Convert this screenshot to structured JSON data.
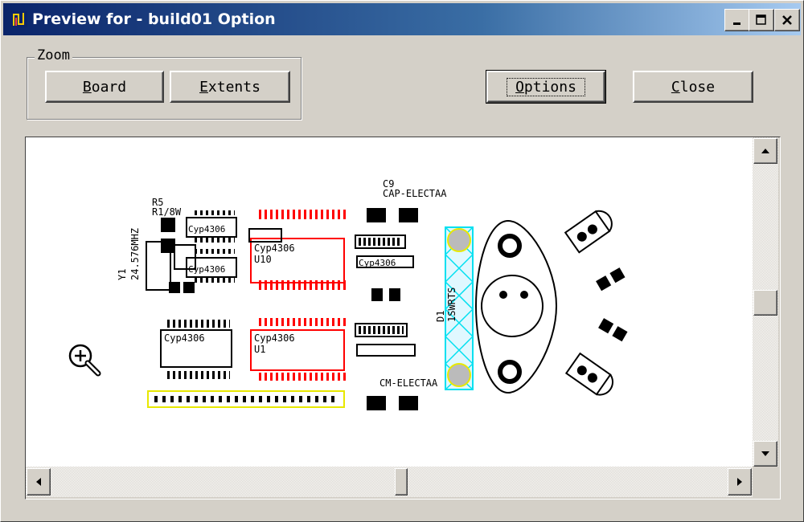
{
  "window": {
    "title": "Preview for - build01 Option",
    "controls": {
      "minimize": "minimize-icon",
      "maximize": "maximize-icon",
      "close": "close-icon"
    }
  },
  "zoom": {
    "label": "Zoom",
    "board_button": {
      "accel": "B",
      "rest": "oard"
    },
    "extents_button": {
      "accel": "E",
      "rest": "xtents"
    }
  },
  "actions": {
    "options_button": {
      "accel": "O",
      "rest": "ptions"
    },
    "close_button": {
      "accel": "C",
      "rest": "lose"
    }
  },
  "board": {
    "labels": {
      "r5": "R5",
      "r1_8w": "R1/8W",
      "y1": "Y1",
      "freq": "24.576MHZ",
      "c9": "C9",
      "cap_elect_top": "CAP-ELECTAA",
      "cap_elect_bottom": "CM-ELECTAA",
      "chip1": "Cyp4306",
      "chip2": "Cyp4306",
      "chip3": "Cyp4306",
      "chip4": "Cyp4306",
      "chip5": "Cyp4306",
      "chip6": "Cyp4306",
      "u10": "U10",
      "u1": "U1",
      "d1": "D1",
      "bw_rot": "1SWRTS"
    },
    "colors": {
      "silkscreen": "#000000",
      "red_layer": "#ff0000",
      "cyan_layer": "#00e0f0",
      "yellow_layer": "#e8e800",
      "background": "#ffffff"
    }
  },
  "cursor": {
    "icon": "zoom-in-magnifier-icon"
  }
}
